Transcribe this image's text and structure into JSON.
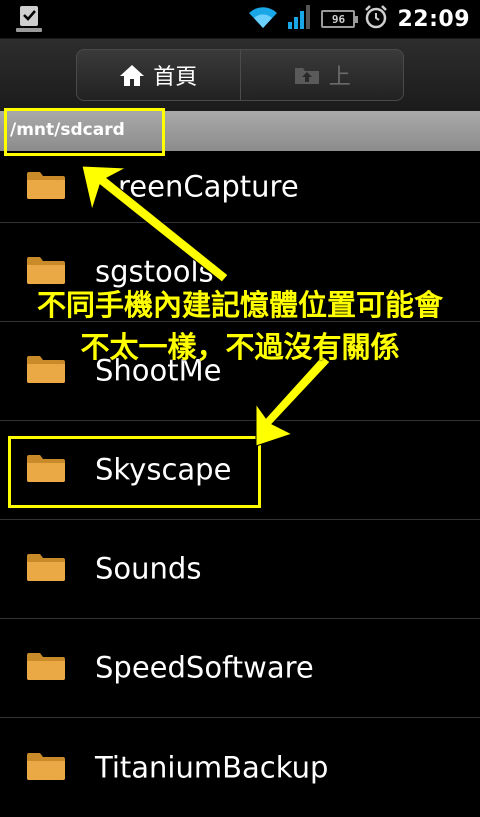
{
  "status_bar": {
    "time": "22:09",
    "battery_level": "96",
    "icons": [
      "download-notification-icon",
      "wifi-icon",
      "signal-icon",
      "battery-icon",
      "alarm-icon"
    ]
  },
  "toolbar": {
    "home_label": "首頁",
    "up_label": "上"
  },
  "path": "/mnt/sdcard",
  "files": [
    {
      "name": "ScreenCapture",
      "visible_text": "reenCapture"
    },
    {
      "name": "sgstools"
    },
    {
      "name": "ShootMe"
    },
    {
      "name": "Skyscape"
    },
    {
      "name": "Sounds"
    },
    {
      "name": "SpeedSoftware"
    },
    {
      "name": "TitaniumBackup"
    }
  ],
  "annotation": {
    "line1": "不同手機內建記憶體位置可能會",
    "line2": "不太一樣，不過沒有關係",
    "color": "#ffff00"
  },
  "colors": {
    "folder": "#e2a23a",
    "path_bar": "#9a9a9a",
    "background": "#000000"
  }
}
